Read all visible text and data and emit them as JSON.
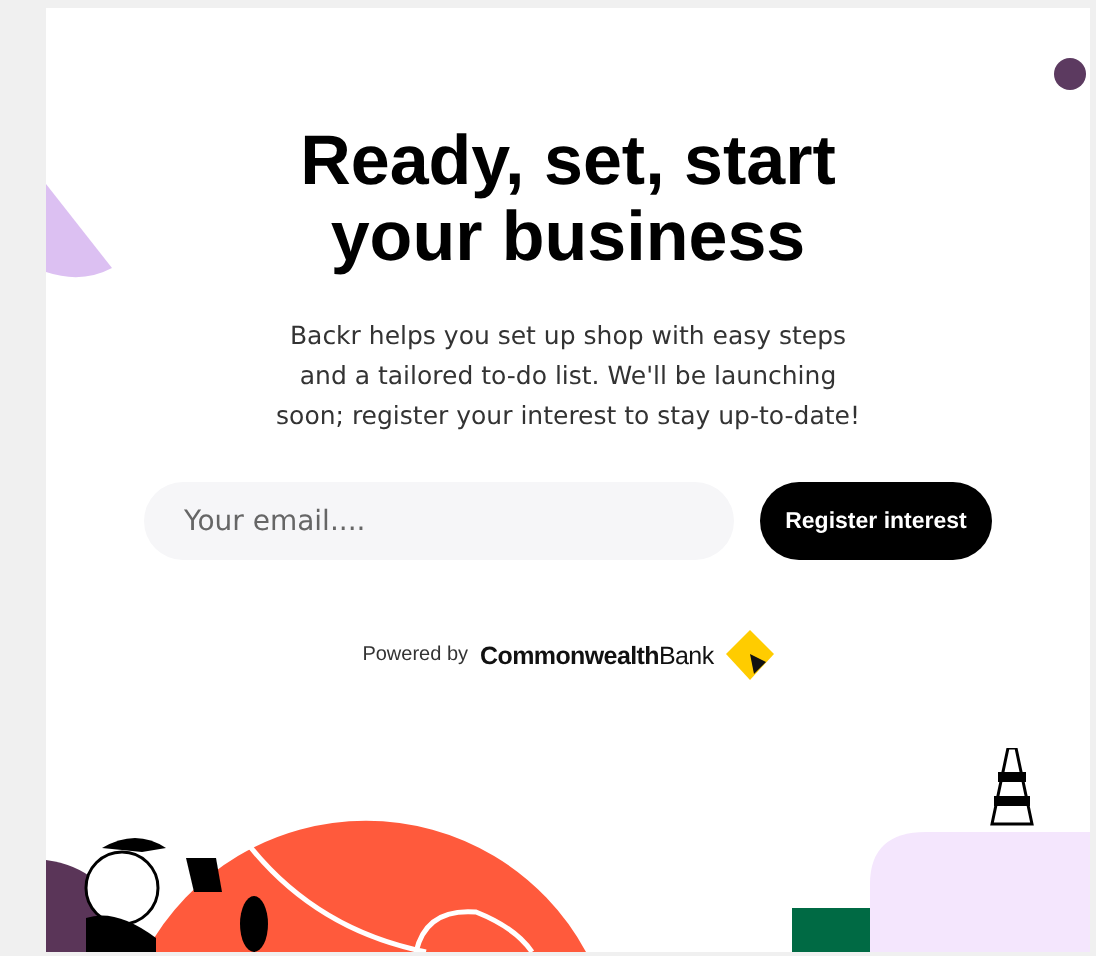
{
  "heading": "Ready, set, start your business",
  "description": "Backr helps you set up shop with easy steps and a tailored to-do list. We'll be launching soon; register your interest to stay up-to-date!",
  "email_field": {
    "placeholder": "Your email...."
  },
  "register_button": {
    "label": "Register interest"
  },
  "powered_by": {
    "label": "Powered by",
    "brand": "**Commonwealth**Bank"
  }
}
